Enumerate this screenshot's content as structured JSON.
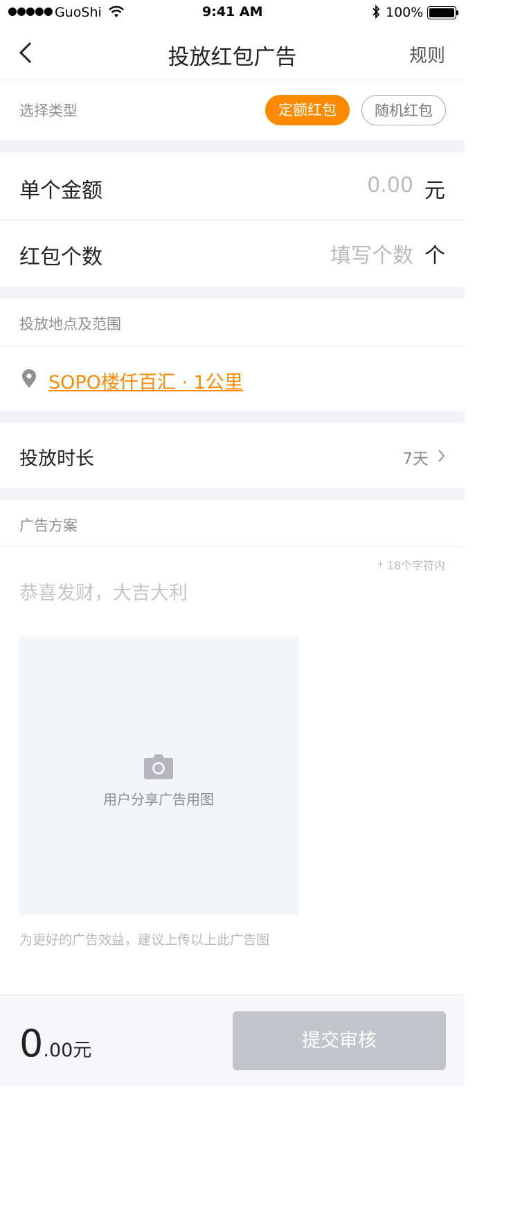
{
  "status_bar": {
    "signal_dots": "●●●●●",
    "carrier": "GuoShi",
    "time": "9:41 AM",
    "battery": "100%"
  },
  "nav": {
    "title": "投放红包广告",
    "rules": "规则"
  },
  "type_select": {
    "label": "选择类型",
    "options": [
      {
        "label": "定额红包",
        "selected": true
      },
      {
        "label": "随机红包",
        "selected": false
      }
    ]
  },
  "amount": {
    "label": "单个金额",
    "placeholder": "0.00",
    "unit": "元"
  },
  "count": {
    "label": "红包个数",
    "placeholder": "填写个数",
    "unit": "个"
  },
  "location": {
    "header": "投放地点及范围",
    "value": "SOPO楼仟百汇 · 1公里"
  },
  "duration": {
    "label": "投放时长",
    "value": "7天"
  },
  "ad_plan": {
    "header": "广告方案",
    "limit_hint": "* 18个字符内",
    "placeholder": "恭喜发财，大吉大利",
    "upload_label": "用户分享广告用图",
    "suggestion": "为更好的广告效益，建议上传以上此广告图"
  },
  "footer": {
    "total_int": "0",
    "total_dec": ".00",
    "total_unit": "元",
    "submit": "提交审核"
  },
  "colors": {
    "accent": "#ff8a00",
    "bg_gray": "#f4f4f8",
    "muted": "#8e8e93",
    "placeholder": "#b9b9bf",
    "submit_disabled": "#c4c4cb"
  }
}
